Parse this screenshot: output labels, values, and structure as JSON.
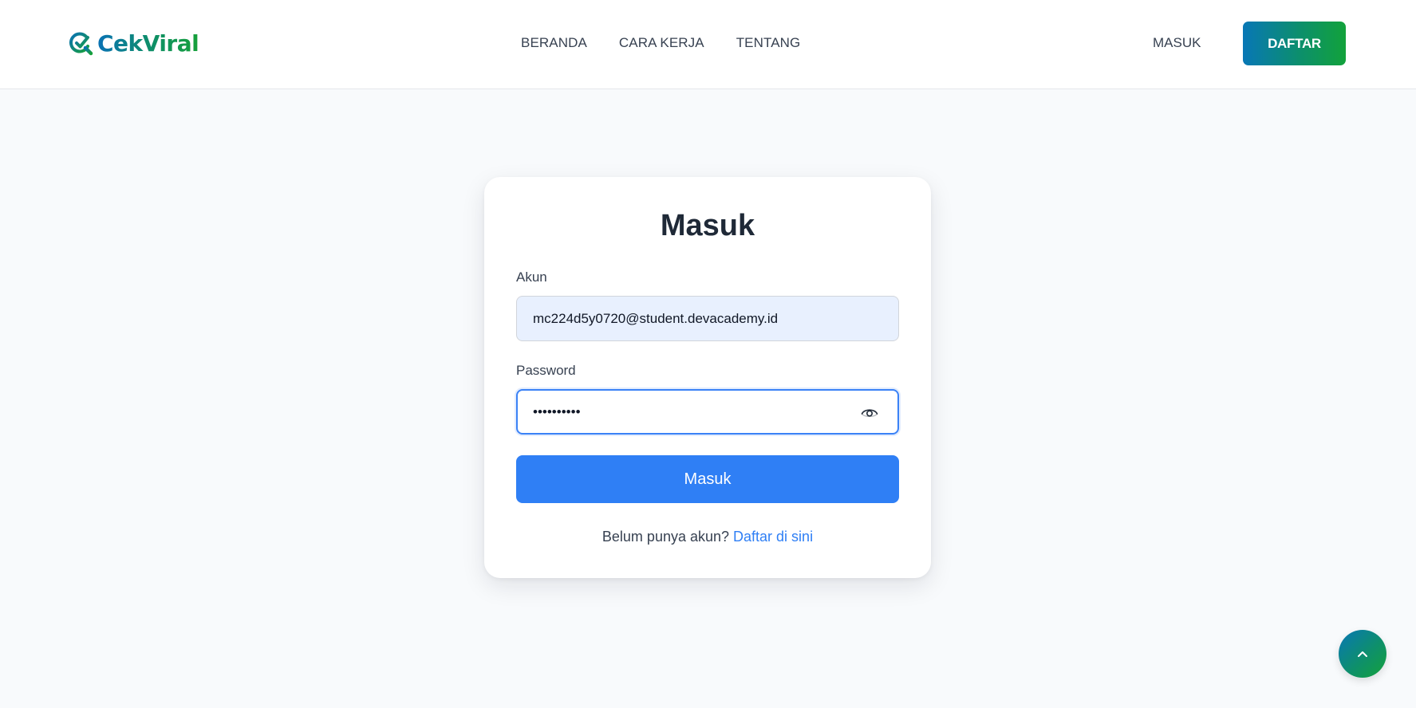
{
  "brand": {
    "name": "CekViral",
    "gradient_start": "#0a72b5",
    "gradient_end": "#16a03a"
  },
  "nav": {
    "links": [
      {
        "label": "BERANDA"
      },
      {
        "label": "CARA KERJA"
      },
      {
        "label": "TENTANG"
      }
    ],
    "login_label": "MASUK",
    "register_label": "DAFTAR"
  },
  "login_card": {
    "title": "Masuk",
    "account_label": "Akun",
    "account_value": "mc224d5y0720@student.devacademy.id",
    "password_label": "Password",
    "password_value": "••••••••••",
    "password_toggle_icon": "eye-icon",
    "submit_label": "Masuk",
    "signup_prompt": "Belum punya akun?",
    "signup_link": "Daftar di sini"
  },
  "scroll_top": {
    "icon": "chevron-up-icon"
  },
  "colors": {
    "primary": "#2f7ff5",
    "background": "#f8fafc",
    "focus_border": "#3b82f6",
    "autofill_bg": "#e8f0fe"
  }
}
